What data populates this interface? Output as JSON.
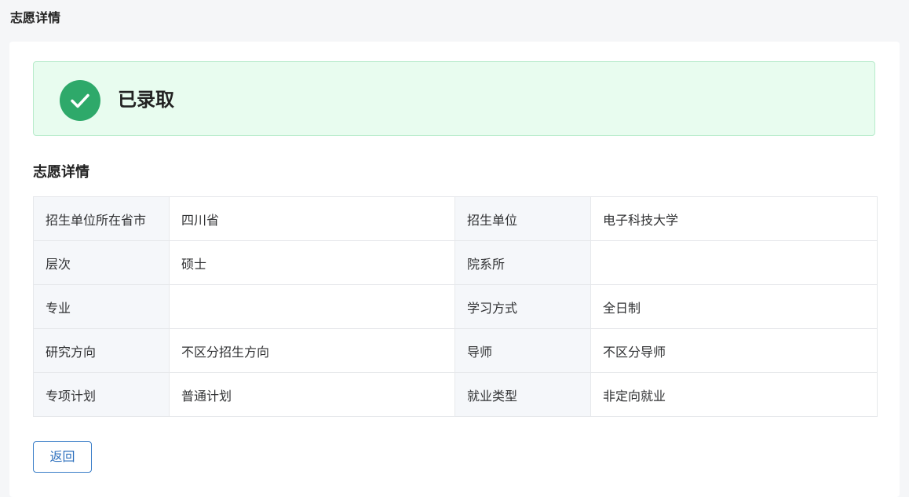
{
  "page": {
    "title": "志愿详情"
  },
  "status": {
    "text": "已录取",
    "icon": "check-circle-icon",
    "color": "#2ea96a",
    "background": "#e8fcef"
  },
  "section": {
    "title": "志愿详情"
  },
  "details": {
    "rows": [
      [
        {
          "label": "招生单位所在省市",
          "value": "四川省"
        },
        {
          "label": "招生单位",
          "value": "电子科技大学"
        }
      ],
      [
        {
          "label": "层次",
          "value": "硕士"
        },
        {
          "label": "院系所",
          "value": ""
        }
      ],
      [
        {
          "label": "专业",
          "value": ""
        },
        {
          "label": "学习方式",
          "value": "全日制"
        }
      ],
      [
        {
          "label": "研究方向",
          "value": "不区分招生方向"
        },
        {
          "label": "导师",
          "value": "不区分导师"
        }
      ],
      [
        {
          "label": "专项计划",
          "value": "普通计划"
        },
        {
          "label": "就业类型",
          "value": "非定向就业"
        }
      ]
    ]
  },
  "actions": {
    "back_label": "返回"
  }
}
